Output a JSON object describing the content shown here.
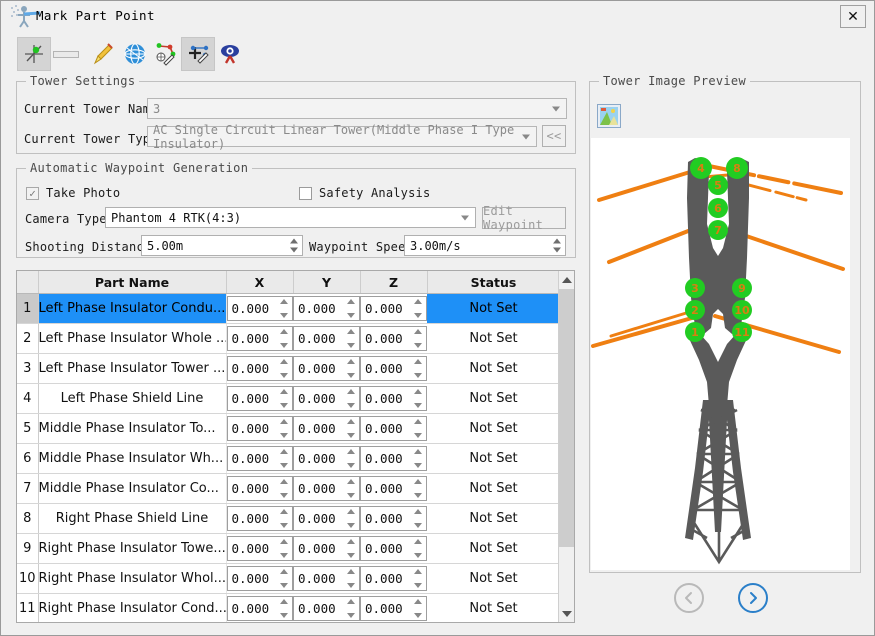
{
  "window": {
    "title": "Mark Part Point",
    "close_label": "✕",
    "app_icon": "mark-part-point-icon"
  },
  "toolbar": {
    "buttons": [
      {
        "name": "mark-point-icon",
        "active": true
      },
      {
        "name": "separator-icon",
        "active": false
      },
      {
        "name": "brush-icon",
        "active": false
      },
      {
        "name": "globe-icon",
        "active": false
      },
      {
        "name": "measure-path-icon",
        "active": false
      },
      {
        "name": "add-waypoint-icon",
        "active": true
      },
      {
        "name": "eye-inspect-icon",
        "active": false
      }
    ]
  },
  "tower_settings": {
    "title": "Tower Settings",
    "current_tower_name_label": "Current Tower Name:",
    "current_tower_name_value": "3",
    "current_tower_type_label": "Current Tower Type:",
    "current_tower_type_value": "AC Single Circuit Linear Tower(Middle Phase I Type Insulator)",
    "collapse_button_label": "<<"
  },
  "waypoint_generation": {
    "title": "Automatic Waypoint Generation",
    "take_photo_label": "Take Photo",
    "take_photo_checked": true,
    "safety_analysis_label": "Safety Analysis",
    "safety_analysis_checked": false,
    "camera_type_label": "Camera Type:",
    "camera_type_value": "Phantom 4 RTK(4:3)",
    "edit_waypoint_label": "Edit Waypoint",
    "shooting_distance_label": "Shooting Distance:",
    "shooting_distance_value": "5.00m",
    "waypoint_speed_label": "Waypoint Speed:",
    "waypoint_speed_value": "3.00m/s"
  },
  "parts_table": {
    "columns": [
      "",
      "Part Name",
      "X",
      "Y",
      "Z",
      "Status"
    ],
    "rows": [
      {
        "num": "1",
        "name": "Left Phase Insulator Condu...",
        "x": "0.000",
        "y": "0.000",
        "z": "0.000",
        "status": "Not Set",
        "selected": true,
        "centered": false
      },
      {
        "num": "2",
        "name": "Left Phase Insulator Whole ...",
        "x": "0.000",
        "y": "0.000",
        "z": "0.000",
        "status": "Not Set",
        "selected": false,
        "centered": false
      },
      {
        "num": "3",
        "name": "Left Phase Insulator Tower ...",
        "x": "0.000",
        "y": "0.000",
        "z": "0.000",
        "status": "Not Set",
        "selected": false,
        "centered": false
      },
      {
        "num": "4",
        "name": "Left Phase Shield Line",
        "x": "0.000",
        "y": "0.000",
        "z": "0.000",
        "status": "Not Set",
        "selected": false,
        "centered": true
      },
      {
        "num": "5",
        "name": "Middle Phase Insulator To...",
        "x": "0.000",
        "y": "0.000",
        "z": "0.000",
        "status": "Not Set",
        "selected": false,
        "centered": false
      },
      {
        "num": "6",
        "name": "Middle Phase Insulator Wh...",
        "x": "0.000",
        "y": "0.000",
        "z": "0.000",
        "status": "Not Set",
        "selected": false,
        "centered": false
      },
      {
        "num": "7",
        "name": "Middle Phase Insulator Co...",
        "x": "0.000",
        "y": "0.000",
        "z": "0.000",
        "status": "Not Set",
        "selected": false,
        "centered": false
      },
      {
        "num": "8",
        "name": "Right Phase Shield Line",
        "x": "0.000",
        "y": "0.000",
        "z": "0.000",
        "status": "Not Set",
        "selected": false,
        "centered": true
      },
      {
        "num": "9",
        "name": "Right Phase Insulator Towe...",
        "x": "0.000",
        "y": "0.000",
        "z": "0.000",
        "status": "Not Set",
        "selected": false,
        "centered": false
      },
      {
        "num": "10",
        "name": "Right Phase Insulator Whol...",
        "x": "0.000",
        "y": "0.000",
        "z": "0.000",
        "status": "Not Set",
        "selected": false,
        "centered": false
      },
      {
        "num": "11",
        "name": "Right Phase Insulator Cond...",
        "x": "0.000",
        "y": "0.000",
        "z": "0.000",
        "status": "Not Set",
        "selected": false,
        "centered": false
      }
    ]
  },
  "preview": {
    "title": "Tower Image Preview",
    "image_button_icon": "picture-icon",
    "prev_button_icon": "chevron-left-icon",
    "next_button_icon": "chevron-right-icon",
    "prev_enabled": false,
    "next_enabled": true,
    "marker_labels": [
      "1",
      "2",
      "3",
      "4",
      "5",
      "6",
      "7",
      "8",
      "9",
      "10",
      "11"
    ]
  },
  "colors": {
    "selection_blue": "#1e90f7",
    "marker_green": "#22cc22",
    "conductor_orange": "#ef7f12",
    "tower_gray": "#5a5a5a",
    "window_bg": "#f0f0f0",
    "next_arrow_blue": "#2a7fc9"
  }
}
